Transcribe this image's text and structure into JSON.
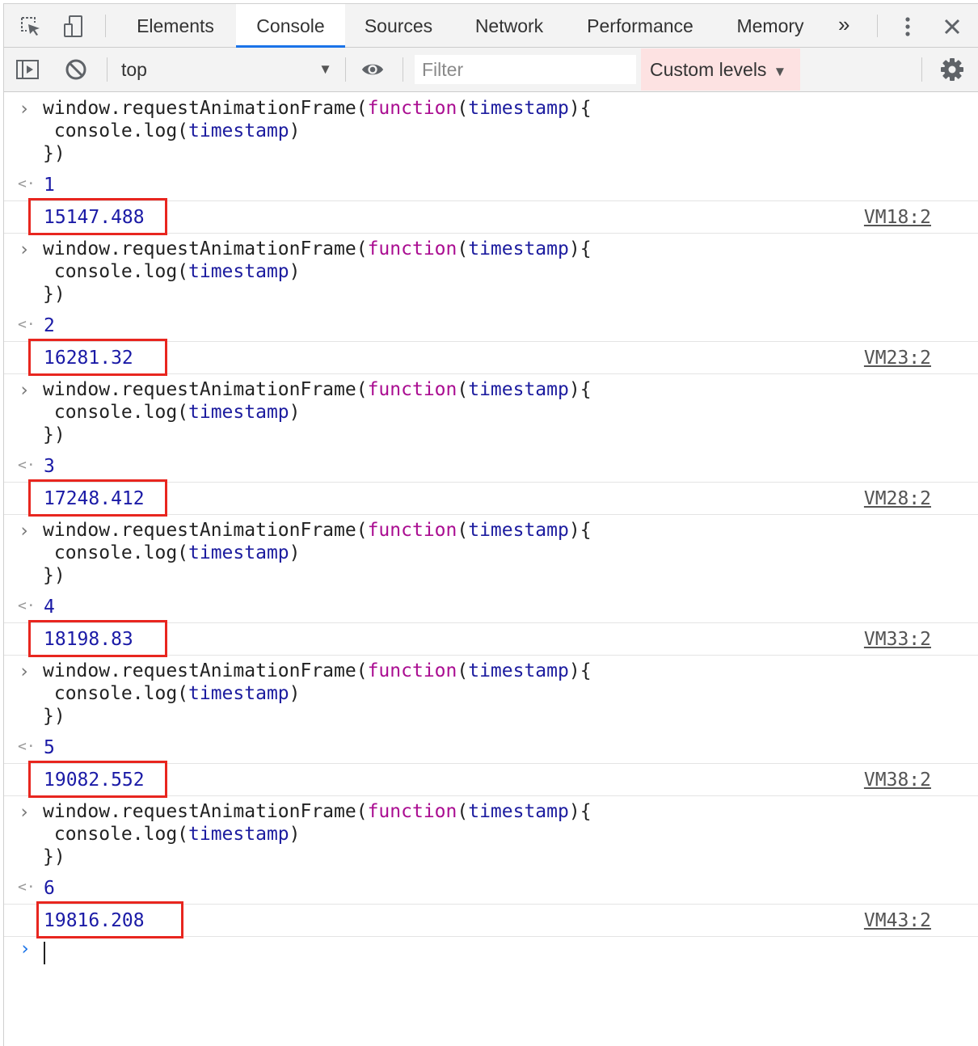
{
  "tabs": [
    {
      "label": "Elements",
      "active": false
    },
    {
      "label": "Console",
      "active": true
    },
    {
      "label": "Sources",
      "active": false
    },
    {
      "label": "Network",
      "active": false
    },
    {
      "label": "Performance",
      "active": false
    },
    {
      "label": "Memory",
      "active": false
    }
  ],
  "tabbar": {
    "overflow_label": "»"
  },
  "toolbar": {
    "context": "top",
    "filter_placeholder": "Filter",
    "levels_label": "Custom levels"
  },
  "code": {
    "line1_a": "window.requestAnimationFrame(",
    "line1_kw": "function",
    "line1_b": "(",
    "line1_param": "timestamp",
    "line1_c": "){",
    "line2_a": " console.log(",
    "line2_param": "timestamp",
    "line2_b": ")",
    "line3": "})"
  },
  "entries": [
    {
      "return_value": "1",
      "log_value": "15147.488",
      "source": "VM18:2"
    },
    {
      "return_value": "2",
      "log_value": "16281.32",
      "source": "VM23:2"
    },
    {
      "return_value": "3",
      "log_value": "17248.412",
      "source": "VM28:2"
    },
    {
      "return_value": "4",
      "log_value": "18198.83",
      "source": "VM33:2"
    },
    {
      "return_value": "5",
      "log_value": "19082.552",
      "source": "VM38:2"
    },
    {
      "return_value": "6",
      "log_value": "19816.208",
      "source": "VM43:2"
    }
  ],
  "colors": {
    "accent": "#1a73e8",
    "highlight_box": "#e8261f",
    "levels_bg": "#fde2e2",
    "number": "#1a1aa6",
    "keyword": "#aa0d91"
  }
}
